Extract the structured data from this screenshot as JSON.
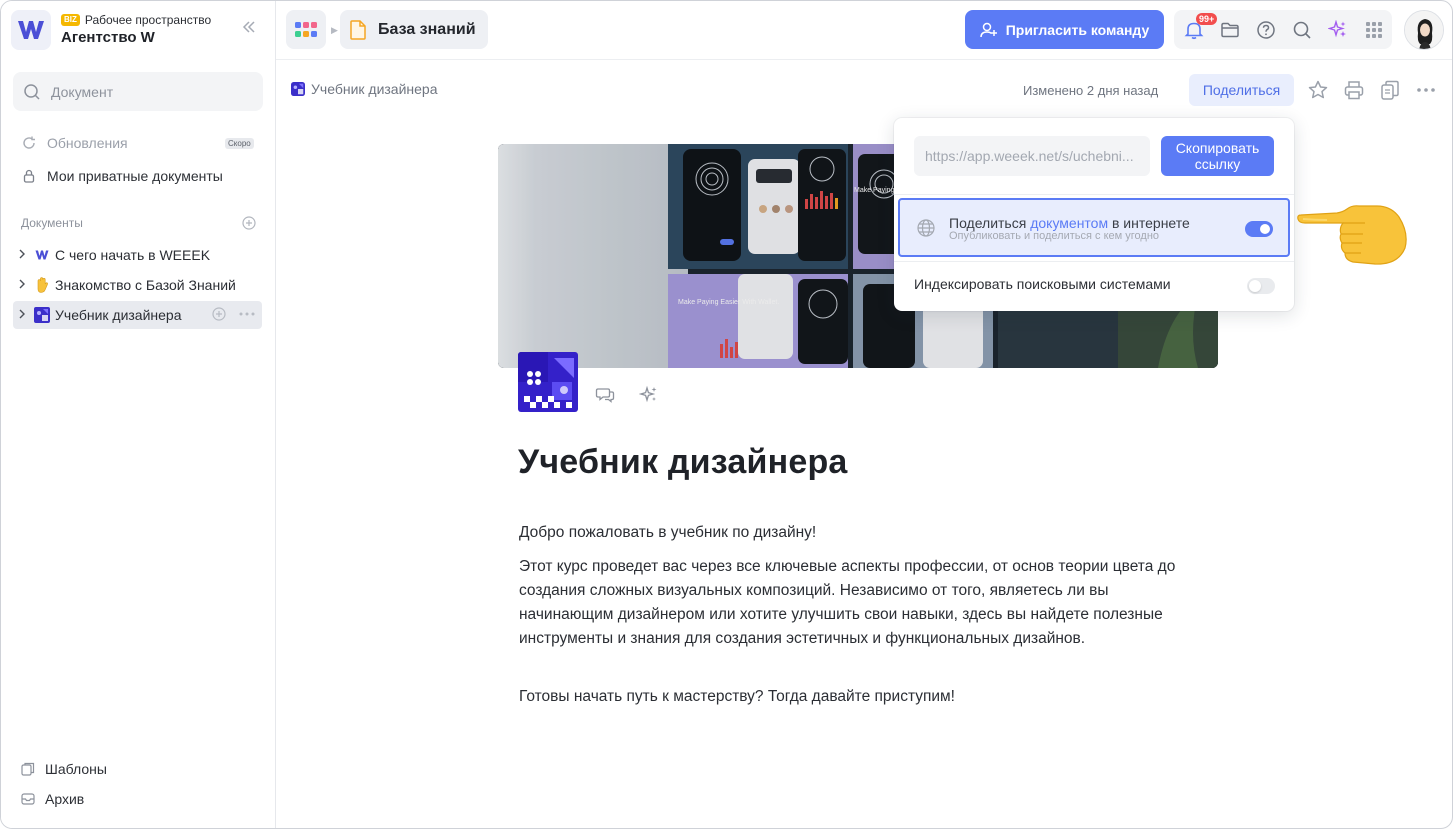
{
  "workspace": {
    "badge": "BIZ",
    "label": "Рабочее пространство",
    "name": "Агентство W"
  },
  "sidebar": {
    "search_placeholder": "Документ",
    "updates": {
      "label": "Обновления",
      "badge": "Скоро"
    },
    "private_docs": "Мои приватные документы",
    "documents_title": "Документы",
    "tree": [
      {
        "label": "С чего начать в WEEEK"
      },
      {
        "label": "Знакомство с Базой Знаний"
      },
      {
        "label": "Учебник дизайнера"
      }
    ],
    "templates": "Шаблоны",
    "archive": "Архив"
  },
  "header": {
    "breadcrumb": "База знаний",
    "invite": "Пригласить команду",
    "notifications_count": "99+"
  },
  "document": {
    "breadcrumb": "Учебник дизайнера",
    "modified": "Изменено 2 дня назад",
    "share_button": "Поделиться",
    "title": "Учебник дизайнера",
    "paragraphs": [
      "Добро пожаловать в учебник по дизайну!",
      "Этот курс проведет вас через все ключевые аспекты профессии, от основ теории цвета до создания сложных визуальных композиций. Независимо от того, являетесь ли вы начинающим дизайнером или хотите улучшить свои навыки, здесь вы найдете полезные инструменты и знания для создания эстетичных и функциональных дизайнов.",
      "Готовы начать путь к мастерству? Тогда давайте приступим!"
    ],
    "cover_texts": [
      "Make Paying Easier With Wallet.",
      "Make Paying Easier With Wallet."
    ]
  },
  "share_popover": {
    "link": "https://app.weeek.net/s/uchebni...",
    "copy_button": "Скопировать ссылку",
    "publish_prefix": "Поделиться ",
    "publish_link": "документом",
    "publish_suffix": " в интернете",
    "publish_hint": "Опубликовать и поделиться с кем угодно",
    "publish_enabled": true,
    "index_label": "Индексировать поисковыми системами",
    "index_enabled": false
  },
  "colors": {
    "accent": "#5b7bf5",
    "badge_red": "#f24d4d",
    "biz_yellow": "#f5b800"
  }
}
